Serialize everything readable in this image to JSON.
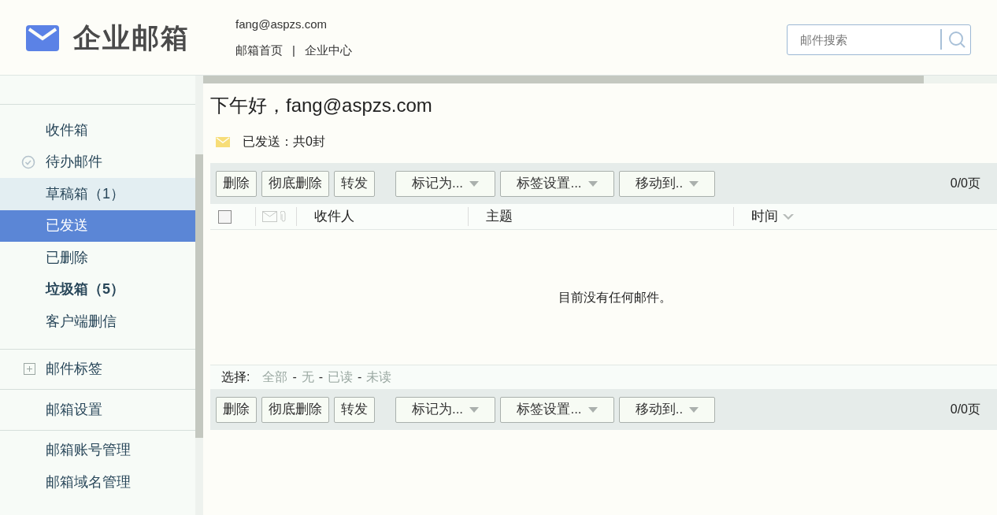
{
  "header": {
    "logo": "企业邮箱",
    "account": "fang@aspzs.com",
    "links": [
      "邮箱首页",
      "企业中心"
    ],
    "separator": "|",
    "search": {
      "placeholder": "邮件搜索"
    }
  },
  "sidebar": {
    "sections": [
      {
        "items": [
          {
            "label": "收件箱",
            "kind": "folder",
            "selected": false,
            "highlighted": false,
            "bold": false
          },
          {
            "label": "待办邮件",
            "kind": "todo",
            "selected": false,
            "highlighted": false,
            "bold": false
          },
          {
            "label": "草稿箱（1）",
            "kind": "folder",
            "selected": false,
            "highlighted": true,
            "bold": false
          },
          {
            "label": "已发送",
            "kind": "folder",
            "selected": true,
            "highlighted": false,
            "bold": false
          },
          {
            "label": "已删除",
            "kind": "folder",
            "selected": false,
            "highlighted": false,
            "bold": false
          },
          {
            "label": "垃圾箱（5）",
            "kind": "folder",
            "selected": false,
            "highlighted": false,
            "bold": true
          },
          {
            "label": "客户端删信",
            "kind": "folder",
            "selected": false,
            "highlighted": false,
            "bold": false
          }
        ]
      },
      {
        "items": [
          {
            "label": "邮件标签",
            "kind": "group",
            "selected": false,
            "highlighted": false,
            "bold": false
          }
        ]
      },
      {
        "items": [
          {
            "label": "邮箱设置",
            "kind": "link",
            "selected": false,
            "highlighted": false,
            "bold": false
          }
        ]
      },
      {
        "items": [
          {
            "label": "邮箱账号管理",
            "kind": "link",
            "selected": false,
            "highlighted": false,
            "bold": false
          },
          {
            "label": "邮箱域名管理",
            "kind": "link",
            "selected": false,
            "highlighted": false,
            "bold": false
          }
        ]
      }
    ]
  },
  "main": {
    "greeting": "下午好，fang@aspzs.com",
    "folder_info": "已发送：共0封",
    "toolbar_top": {
      "buttons": [
        {
          "label": "删除",
          "kind": "plain"
        },
        {
          "label": "彻底删除",
          "kind": "plain"
        },
        {
          "label": "转发",
          "kind": "plain"
        },
        {
          "label": "标记为...",
          "kind": "dropdown"
        },
        {
          "label": "标签设置...",
          "kind": "dropdown"
        },
        {
          "label": "移动到..",
          "kind": "dropdown"
        }
      ],
      "pages": "0/0页"
    },
    "table": {
      "select_all": {
        "checked": false
      },
      "columns": [
        "收件人",
        "主题",
        "时间"
      ],
      "empty_message": "目前没有任何邮件。"
    },
    "select": {
      "label": "选择:",
      "options": [
        "全部",
        "无",
        "已读",
        "未读"
      ],
      "separator": "-"
    },
    "toolbar_bottom": {
      "buttons": [
        {
          "label": "删除",
          "kind": "plain"
        },
        {
          "label": "彻底删除",
          "kind": "plain"
        },
        {
          "label": "转发",
          "kind": "plain"
        },
        {
          "label": "标记为...",
          "kind": "dropdown"
        },
        {
          "label": "标签设置...",
          "kind": "dropdown"
        },
        {
          "label": "移动到..",
          "kind": "dropdown"
        }
      ],
      "pages": "0/0页"
    }
  }
}
